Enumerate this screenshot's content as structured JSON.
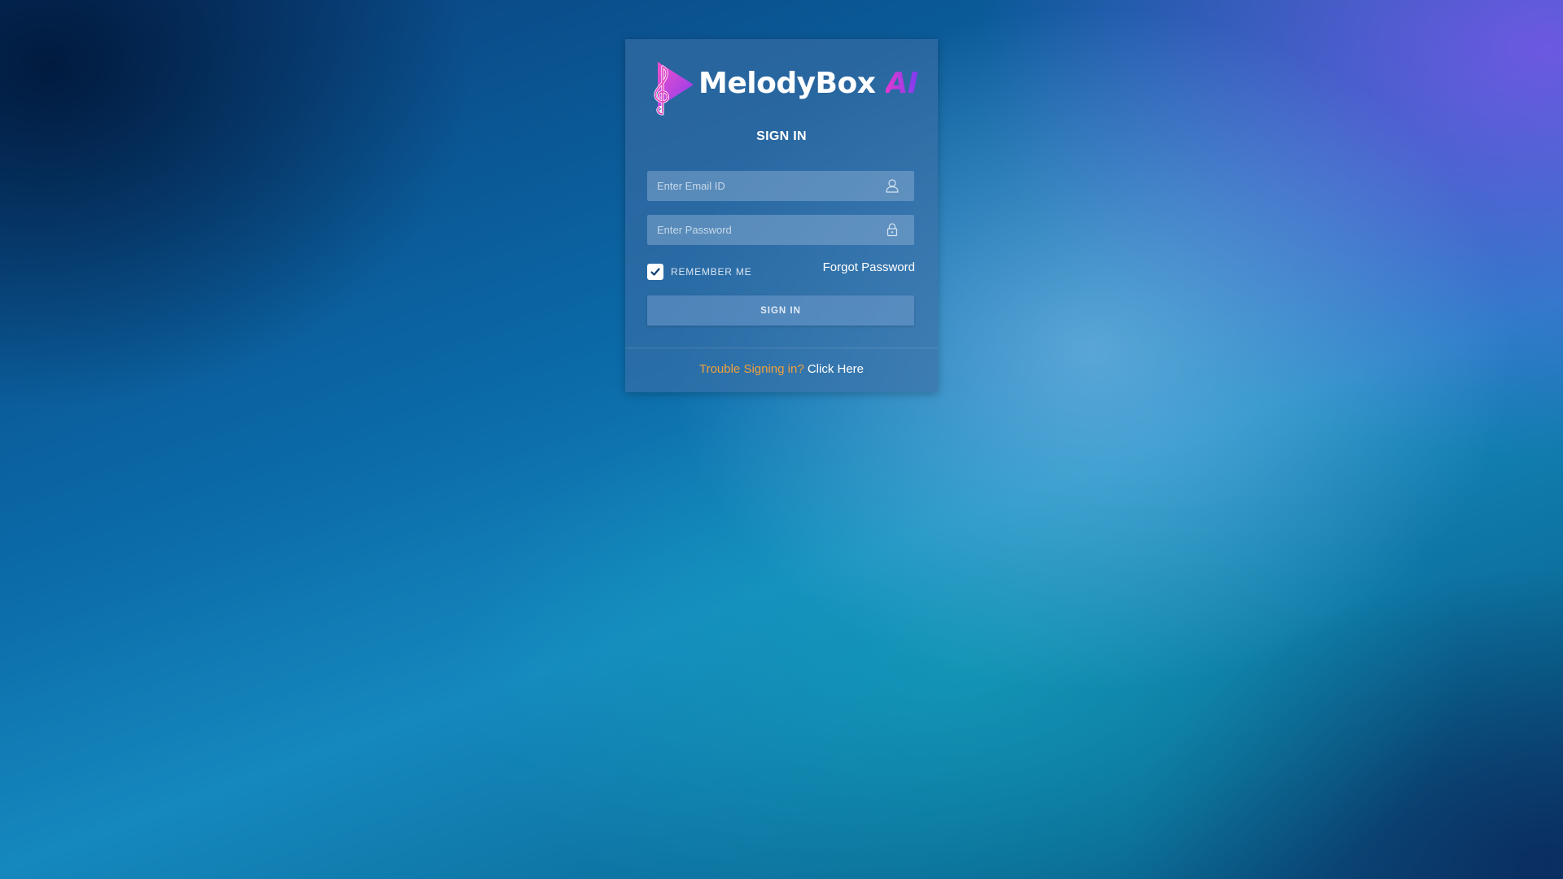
{
  "brand": {
    "name": "MelodyBox",
    "suffix": "AI",
    "logo_icon": "treble-clef-play-icon",
    "colors": {
      "accent_pink": "#e23ad0",
      "accent_purple": "#7b3cf0"
    }
  },
  "signin": {
    "title": "SIGN IN",
    "email": {
      "value": "",
      "placeholder": "Enter Email ID",
      "icon": "user-icon"
    },
    "password": {
      "value": "",
      "placeholder": "Enter Password",
      "icon": "lock-icon"
    },
    "remember_me": {
      "label": "REMEMBER ME",
      "checked": true
    },
    "forgot_password": "Forgot Password",
    "button_label": "SIGN IN"
  },
  "footer": {
    "trouble_text": "Trouble Signing in?",
    "link_text": "Click Here",
    "trouble_color": "#f0a13a"
  }
}
